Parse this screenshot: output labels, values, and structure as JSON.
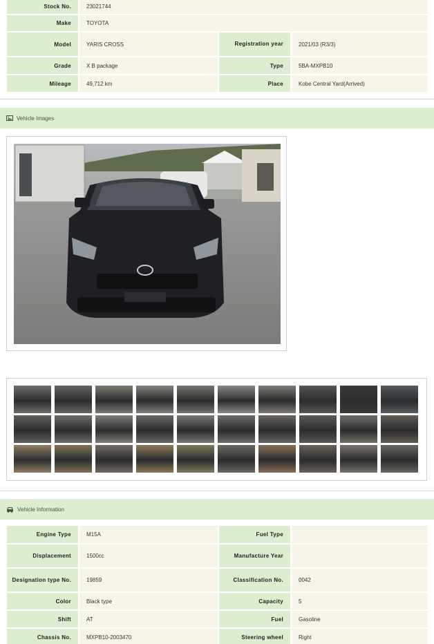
{
  "top_specs": {
    "stock_no_label": "Stock No.",
    "stock_no": "23021744",
    "make_label": "Make",
    "make": "TOYOTA",
    "model_label": "Model",
    "model": "YARIS CROSS",
    "registration_label": "Registration year",
    "registration": "2021/03 (R3/3)",
    "grade_label": "Grade",
    "grade": "X B package",
    "type_label": "Type",
    "type": "5BA-MXPB10",
    "mileage_label": "Mileage",
    "mileage": "49,712 km",
    "place_label": "Place",
    "place": "Kobe Central Yard(Arrived)"
  },
  "images_section": {
    "title": "Vehicle Images",
    "icon": "image-icon"
  },
  "thumbnails": [
    {
      "bg": "#6d6e68"
    },
    {
      "bg": "#636560"
    },
    {
      "bg": "#7a7a72"
    },
    {
      "bg": "#80817a"
    },
    {
      "bg": "#74756e"
    },
    {
      "bg": "#8a8886"
    },
    {
      "bg": "#7f7b76"
    },
    {
      "bg": "#5a5752"
    },
    {
      "bg": "#3a3a3a"
    },
    {
      "bg": "#555a5d"
    },
    {
      "bg": "#5d5f5a"
    },
    {
      "bg": "#6c6e68"
    },
    {
      "bg": "#807d77"
    },
    {
      "bg": "#6a6864"
    },
    {
      "bg": "#7b7873"
    },
    {
      "bg": "#6e6b67"
    },
    {
      "bg": "#686560"
    },
    {
      "bg": "#5c5a55"
    },
    {
      "bg": "#707069"
    },
    {
      "bg": "#605b52"
    },
    {
      "bg": "#8f7e62"
    },
    {
      "bg": "#7f7456"
    },
    {
      "bg": "#6f6b60"
    },
    {
      "bg": "#8b7a5a"
    },
    {
      "bg": "#7d7a5c"
    },
    {
      "bg": "#6a6862"
    },
    {
      "bg": "#876e55"
    },
    {
      "bg": "#6b6258"
    },
    {
      "bg": "#77736b"
    },
    {
      "bg": "#66645f"
    }
  ],
  "info_section": {
    "title": "Vehicle Information",
    "icon": "car-icon"
  },
  "info_specs": {
    "engine_type_label": "Engine Type",
    "engine_type": "M15A",
    "fuel_type_label": "Fuel Type",
    "fuel_type": "",
    "displacement_label": "Displacement",
    "displacement": "1500cc",
    "manufacture_label": "Manufacture Year",
    "manufacture": "",
    "designation_label": "Designation type No.",
    "designation": "19859",
    "classification_label": "Classification No.",
    "classification": "0042",
    "color_label": "Color",
    "color": "Black type",
    "capacity_label": "Capacity",
    "capacity": "5",
    "shift_label": "Shift",
    "shift": "AT",
    "fuel_label": "Fuel",
    "fuel": "Gasoline",
    "chassis_label": "Chassis No.",
    "chassis": "MXPB10-2003470",
    "steering_label": "Steering wheel",
    "steering": "Right"
  }
}
